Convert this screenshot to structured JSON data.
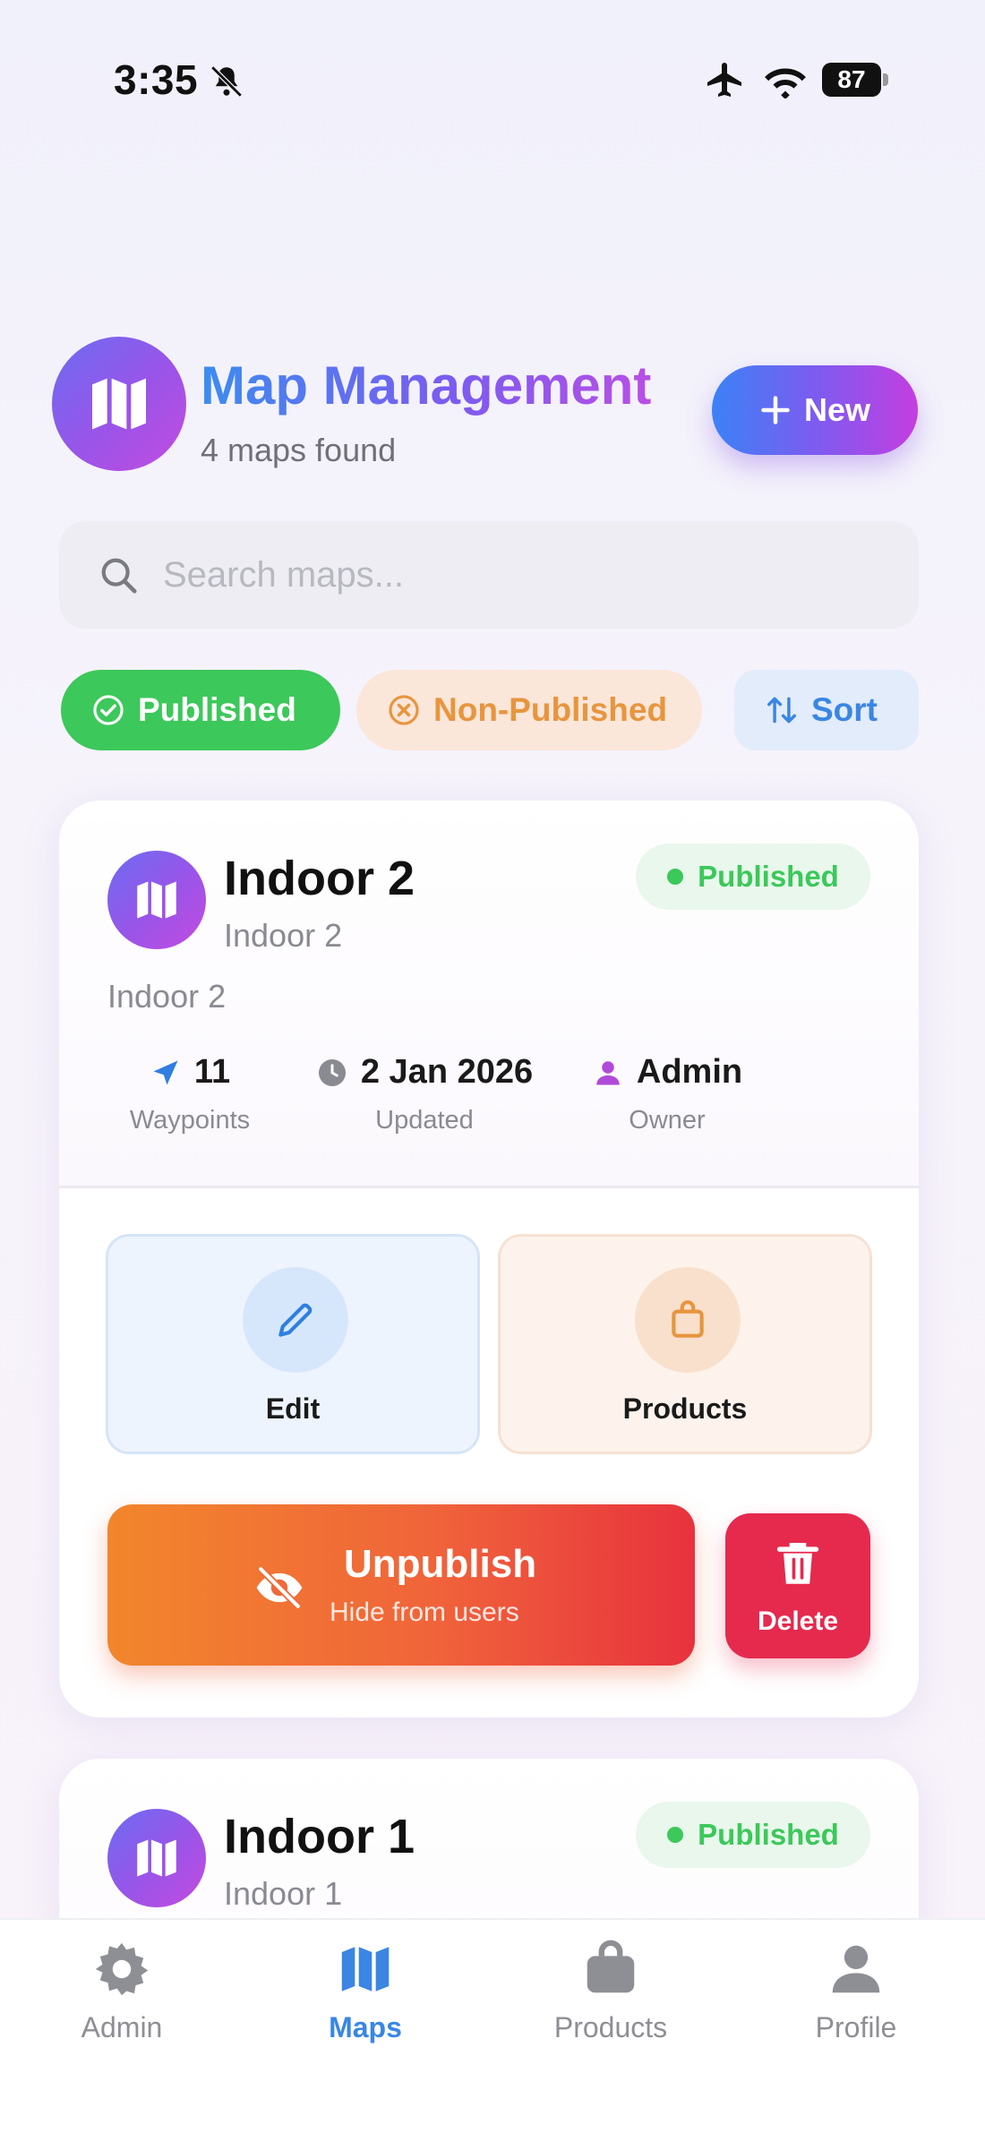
{
  "status_bar": {
    "time": "3:35",
    "battery": "87"
  },
  "header": {
    "title": "Map Management",
    "subtitle": "4 maps found",
    "new_button_label": "New"
  },
  "search": {
    "placeholder": "Search maps..."
  },
  "filters": {
    "published_label": "Published",
    "non_published_label": "Non-Published",
    "sort_label": "Sort"
  },
  "maps": [
    {
      "title": "Indoor 2",
      "subtitle": "Indoor 2",
      "description": "Indoor 2",
      "status": "Published",
      "stats": [
        {
          "value": "11",
          "label": "Waypoints"
        },
        {
          "value": "2 Jan 2026",
          "label": "Updated"
        },
        {
          "value": "Admin",
          "label": "Owner"
        }
      ],
      "actions": {
        "edit_label": "Edit",
        "products_label": "Products",
        "unpublish_label": "Unpublish",
        "unpublish_sub": "Hide from users",
        "delete_label": "Delete"
      }
    },
    {
      "title": "Indoor 1",
      "subtitle": "Indoor 1",
      "status": "Published"
    }
  ],
  "tab_bar": {
    "items": [
      {
        "label": "Admin",
        "icon": "gear-icon"
      },
      {
        "label": "Maps",
        "icon": "map-icon"
      },
      {
        "label": "Products",
        "icon": "bag-icon"
      },
      {
        "label": "Profile",
        "icon": "person-icon"
      }
    ],
    "active": "Maps"
  },
  "colors": {
    "accent_blue": "#3a86e2",
    "published_green": "#3cc85a",
    "non_published_orange": "#e8953e",
    "delete_red": "#e52a4e",
    "gradient_purple": "#9b54e8"
  }
}
